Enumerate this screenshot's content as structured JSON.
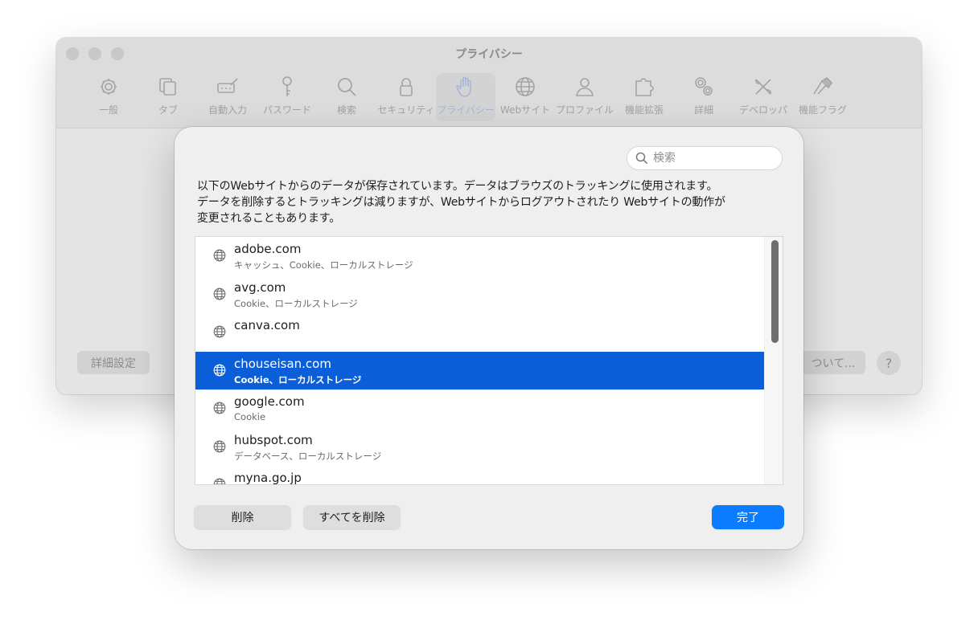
{
  "window": {
    "title": "プライバシー",
    "toolbar": [
      {
        "label": "一般",
        "icon": "gear-icon"
      },
      {
        "label": "タブ",
        "icon": "tabs-icon"
      },
      {
        "label": "自動入力",
        "icon": "autofill-icon"
      },
      {
        "label": "パスワード",
        "icon": "key-icon"
      },
      {
        "label": "検索",
        "icon": "search-icon"
      },
      {
        "label": "セキュリティ",
        "icon": "lock-icon"
      },
      {
        "label": "プライバシー",
        "icon": "hand-icon",
        "active": true
      },
      {
        "label": "Webサイト",
        "icon": "globe-icon"
      },
      {
        "label": "プロファイル",
        "icon": "person-icon"
      },
      {
        "label": "機能拡張",
        "icon": "puzzle-icon"
      },
      {
        "label": "詳細",
        "icon": "gears-icon"
      },
      {
        "label": "デベロッパ",
        "icon": "tools-icon"
      },
      {
        "label": "機能フラグ",
        "icon": "flags-icon"
      }
    ],
    "advanced_button": "詳細設定",
    "about_button": "ついて...",
    "help_button": "?"
  },
  "sheet": {
    "search_placeholder": "検索",
    "description": [
      "以下のWebサイトからのデータが保存されています。データはブラウズのトラッキングに使用されます。",
      "データを削除するとトラッキングは減りますが、Webサイトからログアウトされたり Webサイトの動作が",
      "変更されることもあります。"
    ],
    "sites": [
      {
        "domain": "adobe.com",
        "detail": "キャッシュ、Cookie、ローカルストレージ"
      },
      {
        "domain": "avg.com",
        "detail": "Cookie、ローカルストレージ"
      },
      {
        "domain": "canva.com",
        "detail": ""
      },
      {
        "domain": "chouseisan.com",
        "detail": "Cookie、ローカルストレージ",
        "selected": true
      },
      {
        "domain": "google.com",
        "detail": "Cookie"
      },
      {
        "domain": "hubspot.com",
        "detail": "データベース、ローカルストレージ"
      },
      {
        "domain": "myna.go.jp",
        "detail": ""
      }
    ],
    "remove_button": "削除",
    "remove_all_button": "すべてを削除",
    "done_button": "完了"
  },
  "colors": {
    "accent": "#0b7bff",
    "selection": "#0a5fd8"
  }
}
